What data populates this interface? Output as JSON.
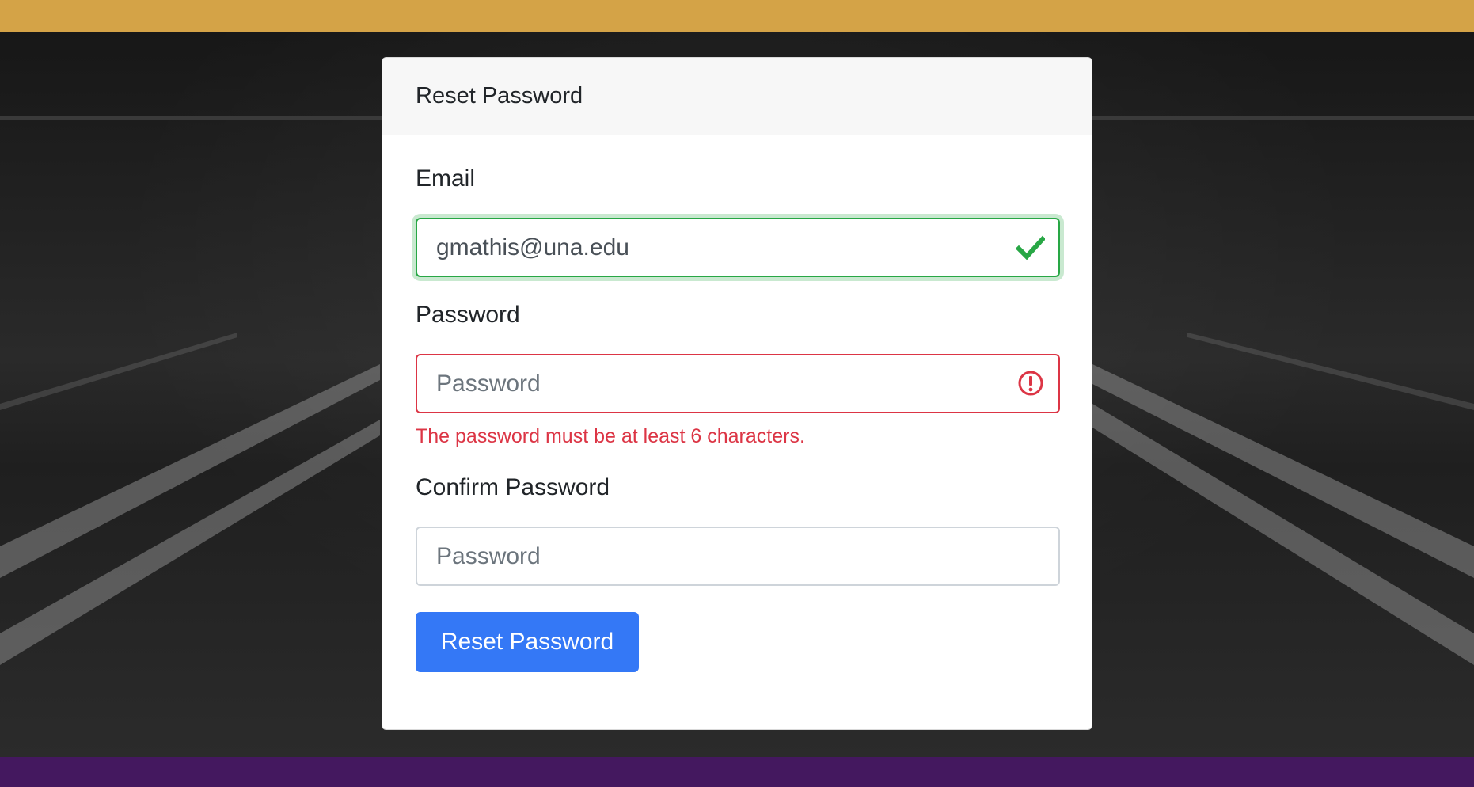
{
  "colors": {
    "top_bar": "#d4a347",
    "bottom_bar": "#44185f",
    "primary": "#3478f6",
    "valid": "#28a745",
    "invalid": "#dc3545"
  },
  "card": {
    "title": "Reset Password"
  },
  "form": {
    "email": {
      "label": "Email",
      "value": "gmathis@una.edu",
      "status_icon": "checkmark-icon"
    },
    "password": {
      "label": "Password",
      "placeholder": "Password",
      "value": "",
      "status_icon": "exclamation-circle-icon",
      "error": "The password must be at least 6 characters."
    },
    "confirm_password": {
      "label": "Confirm Password",
      "placeholder": "Password",
      "value": ""
    },
    "submit_label": "Reset Password"
  }
}
